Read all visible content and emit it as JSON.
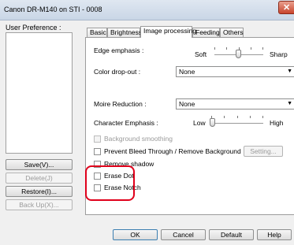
{
  "window": {
    "title": "Canon DR-M140 on STI - 0008",
    "close_symbol": "✕"
  },
  "user_pref": {
    "label": "User Preference :",
    "buttons": {
      "save": "Save(V)...",
      "delete": "Delete(J)",
      "restore": "Restore(I)...",
      "backup": "Back Up(X)..."
    }
  },
  "tabs": [
    "Basic",
    "Brightness",
    "Image processing",
    "Feeding",
    "Others"
  ],
  "image_processing": {
    "edge_emphasis": {
      "label": "Edge emphasis :",
      "min": "Soft",
      "max": "Sharp",
      "value_fraction": 0.5
    },
    "color_dropout": {
      "label": "Color drop-out :",
      "value": "None"
    },
    "moire": {
      "label": "Moire Reduction :",
      "value": "None"
    },
    "character_emphasis": {
      "label": "Character Emphasis :",
      "min": "Low",
      "max": "High",
      "value_fraction": 0.0
    },
    "checkboxes": {
      "background_smoothing": "Background smoothing",
      "prevent_bleed": "Prevent Bleed Through / Remove Background",
      "remove_shadow": "Remove shadow",
      "erase_dot": "Erase Dot",
      "erase_notch": "Erase Notch"
    },
    "setting_button": "Setting..."
  },
  "footer": {
    "ok": "OK",
    "cancel": "Cancel",
    "default": "Default",
    "help": "Help"
  },
  "colors": {
    "highlight": "#e0001b"
  }
}
